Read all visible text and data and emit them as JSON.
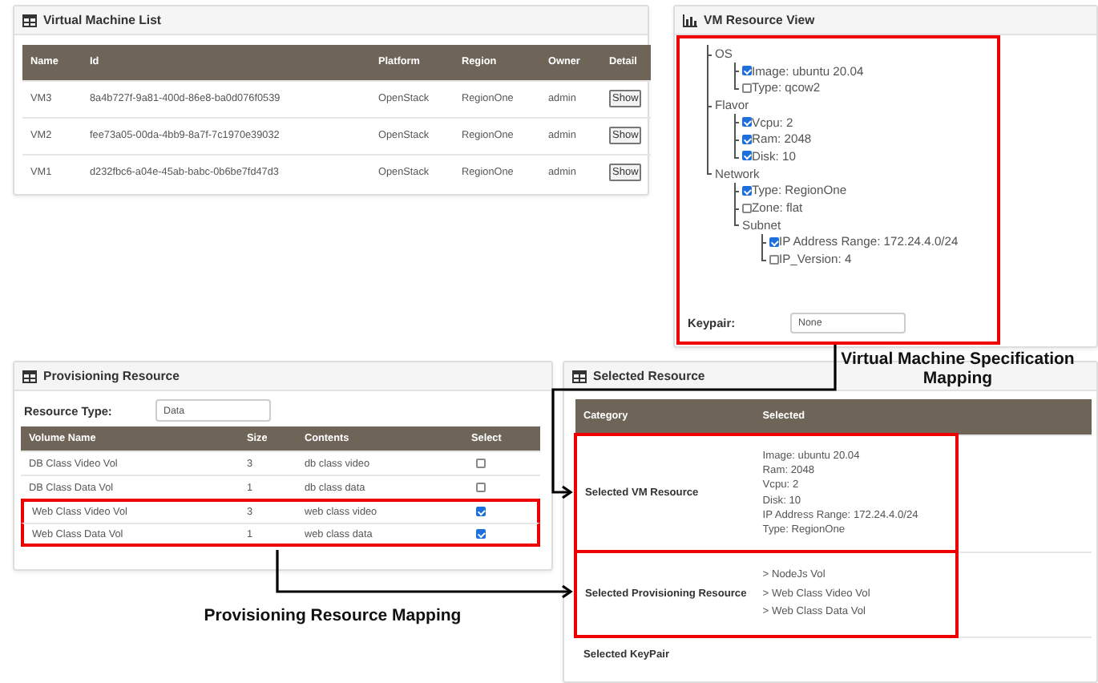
{
  "vm_list": {
    "title": "Virtual Machine List",
    "columns": [
      "Name",
      "Id",
      "Platform",
      "Region",
      "Owner",
      "Detail"
    ],
    "rows": [
      {
        "name": "VM3",
        "id": "8a4b727f-9a81-400d-86e8-ba0d076f0539",
        "platform": "OpenStack",
        "region": "RegionOne",
        "owner": "admin",
        "detail": "Show"
      },
      {
        "name": "VM2",
        "id": "fee73a05-00da-4bb9-8a7f-7c1970e39032",
        "platform": "OpenStack",
        "region": "RegionOne",
        "owner": "admin",
        "detail": "Show"
      },
      {
        "name": "VM1",
        "id": "d232fbc6-a04e-45ab-babc-0b6be7fd47d3",
        "platform": "OpenStack",
        "region": "RegionOne",
        "owner": "admin",
        "detail": "Show"
      }
    ]
  },
  "vm_resource_view": {
    "title": "VM Resource View",
    "highlighted": true,
    "tree": [
      {
        "label": "OS",
        "children": [
          {
            "label": "Image: ubuntu 20.04",
            "checked": true
          },
          {
            "label": "Type: qcow2",
            "checked": false
          }
        ]
      },
      {
        "label": "Flavor",
        "children": [
          {
            "label": "Vcpu: 2",
            "checked": true
          },
          {
            "label": "Ram: 2048",
            "checked": true
          },
          {
            "label": "Disk: 10",
            "checked": true
          }
        ]
      },
      {
        "label": "Network",
        "children": [
          {
            "label": "Type: RegionOne",
            "checked": true
          },
          {
            "label": "Zone: flat",
            "checked": false
          },
          {
            "label": "Subnet",
            "children": [
              {
                "label": "IP Address Range: 172.24.4.0/24",
                "checked": true
              },
              {
                "label": "IP_Version: 4",
                "checked": false
              }
            ]
          }
        ]
      }
    ],
    "keypair": {
      "label": "Keypair:",
      "value": "None"
    }
  },
  "provisioning": {
    "title": "Provisioning Resource",
    "resource_type": {
      "label": "Resource Type:",
      "value": "Data"
    },
    "columns": [
      "Volume Name",
      "Size",
      "Contents",
      "Select"
    ],
    "rows": [
      {
        "volume_name": "DB Class Video Vol",
        "size": "3",
        "contents": "db class video",
        "checked": false,
        "highlighted": false
      },
      {
        "volume_name": "DB Class Data Vol",
        "size": "1",
        "contents": "db class data",
        "checked": false,
        "highlighted": false
      },
      {
        "volume_name": "Web Class Video Vol",
        "size": "3",
        "contents": "web class video",
        "checked": true,
        "highlighted": true
      },
      {
        "volume_name": "Web Class Data Vol",
        "size": "1",
        "contents": "web class data",
        "checked": true,
        "highlighted": true
      }
    ]
  },
  "selected_resource": {
    "title": "Selected Resource",
    "columns": [
      "Category",
      "Selected"
    ],
    "rows": [
      {
        "category": "Selected VM Resource",
        "highlighted": true,
        "lines": [
          "Image: ubuntu 20.04",
          "Ram: 2048",
          "Vcpu: 2",
          "Disk: 10",
          "IP Address Range: 172.24.4.0/24",
          "Type: RegionOne"
        ]
      },
      {
        "category": "Selected Provisioning Resource",
        "highlighted": true,
        "lines": [
          "> NodeJs Vol",
          "> Web Class Video Vol",
          "> Web Class Data Vol"
        ]
      },
      {
        "category": "Selected KeyPair",
        "highlighted": false
      }
    ]
  },
  "annotations": [
    {
      "text": "Virtual Machine Specification Mapping"
    },
    {
      "text": "Provisioning Resource Mapping"
    }
  ]
}
